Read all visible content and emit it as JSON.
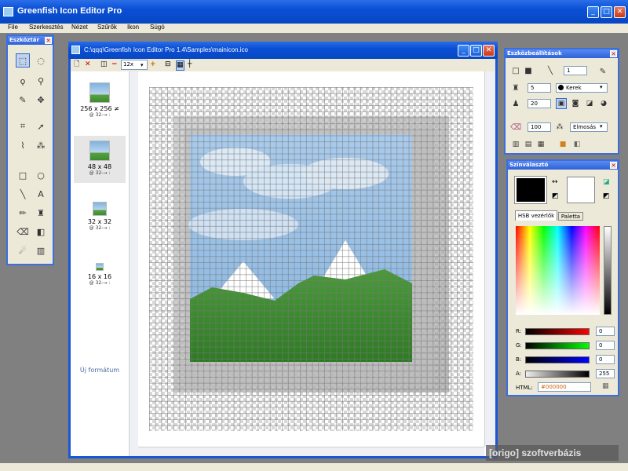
{
  "app": {
    "title": "Greenfish Icon Editor Pro"
  },
  "menu": [
    "File",
    "Szerkesztés",
    "Nézet",
    "Szűrők",
    "Ikon",
    "Súgó"
  ],
  "toolbox": {
    "title": "Eszköztár"
  },
  "document": {
    "title": "C:\\qqq\\Greenfish Icon Editor Pro 1.4\\Samples\\mainicon.ico",
    "zoom": "12x",
    "formats": [
      {
        "label": "256 x 256",
        "badge": "≠",
        "depth": "@ 32-→ :"
      },
      {
        "label": "48 x 48",
        "depth": "@ 32-→ :"
      },
      {
        "label": "32 x 32",
        "depth": "@ 32-→ :"
      },
      {
        "label": "16 x 16",
        "depth": "@ 32-→ :"
      }
    ],
    "new_format": "Új formátum"
  },
  "tool_settings": {
    "title": "Eszközbeállítások",
    "line_width": "1",
    "size": "5",
    "shape": "Kerek",
    "opacity": "20",
    "amount": "100",
    "blend": "Elmosás"
  },
  "color_picker": {
    "title": "Színválasztó",
    "tabs": [
      "HSB vezérlők",
      "Paletta"
    ],
    "labels": {
      "r": "R:",
      "g": "G:",
      "b": "B:",
      "a": "A:",
      "html": "HTML:"
    },
    "r": "0",
    "g": "0",
    "b": "0",
    "a": "255",
    "html": "#000000",
    "primary_color": "#000000",
    "secondary_color": "#ffffff"
  },
  "watermark": "[origo] szoftverbázis"
}
